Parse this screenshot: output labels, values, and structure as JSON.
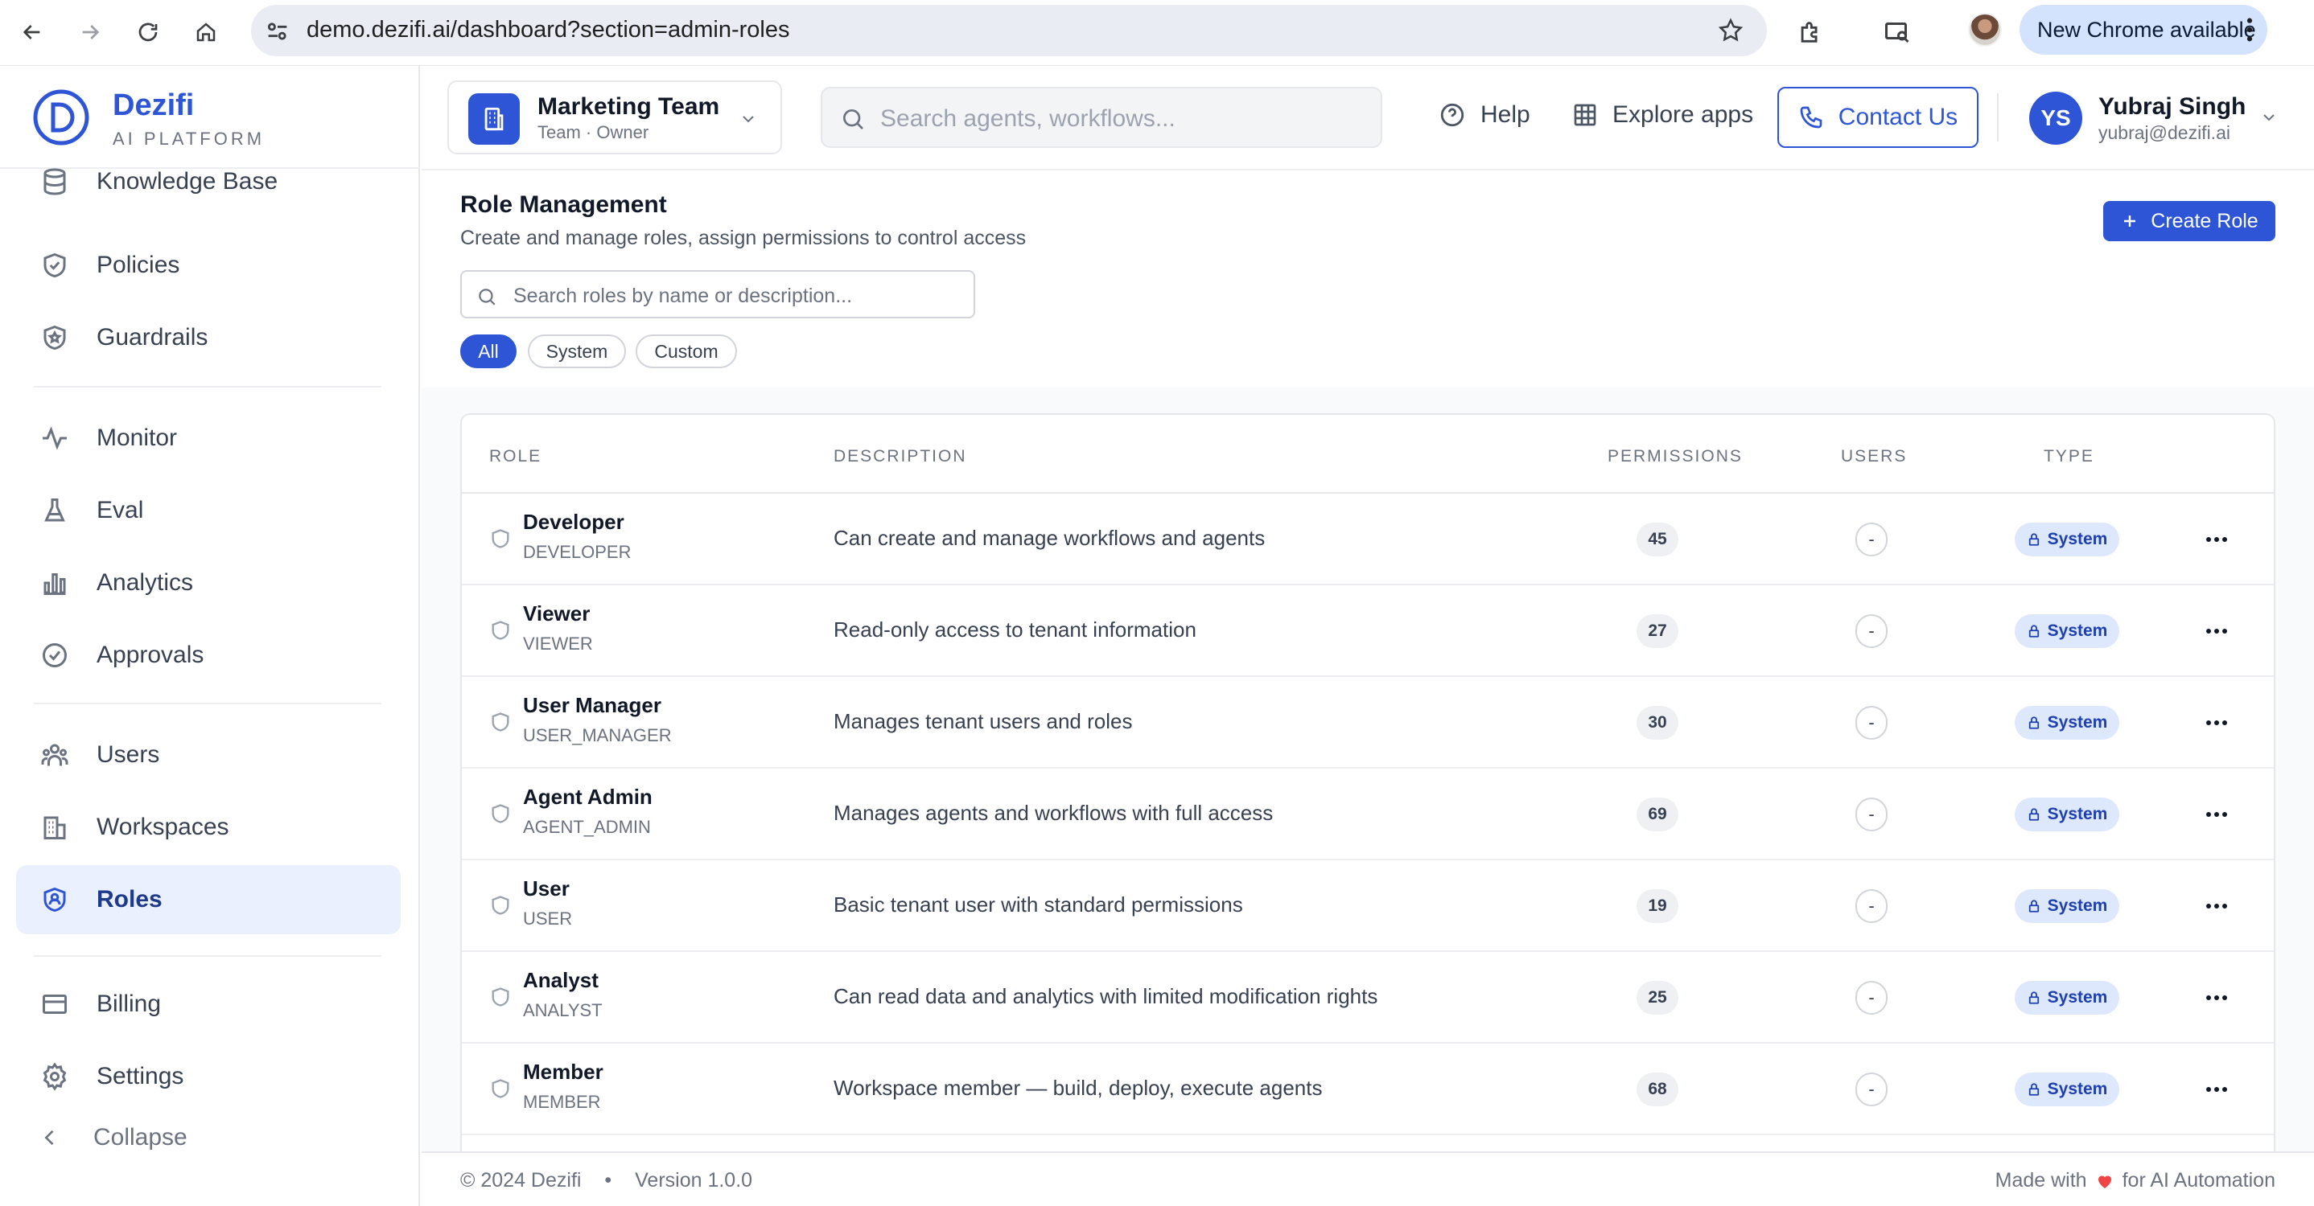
{
  "browser": {
    "url": "demo.dezifi.ai/dashboard?section=admin-roles",
    "update_label": "New Chrome available"
  },
  "brand": {
    "name": "Dezifi",
    "subtitle": "AI PLATFORM",
    "color": "#2d55d6"
  },
  "sidebar": {
    "items": [
      {
        "label": "Knowledge Base",
        "icon": "database-icon"
      },
      {
        "label": "Policies",
        "icon": "shield-check-icon"
      },
      {
        "label": "Guardrails",
        "icon": "shield-star-icon"
      },
      {
        "label": "Monitor",
        "icon": "activity-icon"
      },
      {
        "label": "Eval",
        "icon": "flask-icon"
      },
      {
        "label": "Analytics",
        "icon": "bar-chart-icon"
      },
      {
        "label": "Approvals",
        "icon": "check-circle-icon"
      },
      {
        "label": "Users",
        "icon": "users-icon"
      },
      {
        "label": "Workspaces",
        "icon": "building-icon"
      },
      {
        "label": "Roles",
        "icon": "shield-user-icon",
        "active": true
      },
      {
        "label": "Billing",
        "icon": "card-icon"
      },
      {
        "label": "Settings",
        "icon": "gear-icon"
      }
    ],
    "collapse_label": "Collapse"
  },
  "topbar": {
    "team_name": "Marketing Team",
    "team_sub": "Team · Owner",
    "search_placeholder": "Search agents, workflows...",
    "help_label": "Help",
    "explore_label": "Explore apps",
    "contact_label": "Contact Us",
    "user_initials": "YS",
    "user_name": "Yubraj Singh",
    "user_email": "yubraj@dezifi.ai"
  },
  "page": {
    "title": "Role Management",
    "subtitle": "Create and manage roles, assign permissions to control access",
    "create_label": "Create Role",
    "search_placeholder": "Search roles by name or description...",
    "filters": [
      "All",
      "System",
      "Custom"
    ],
    "active_filter": "All"
  },
  "table": {
    "columns": [
      "ROLE",
      "DESCRIPTION",
      "PERMISSIONS",
      "USERS",
      "TYPE"
    ],
    "rows": [
      {
        "name": "Developer",
        "code": "DEVELOPER",
        "description": "Can create and manage workflows and agents",
        "permissions": "45",
        "users": "-",
        "type": "System"
      },
      {
        "name": "Viewer",
        "code": "VIEWER",
        "description": "Read-only access to tenant information",
        "permissions": "27",
        "users": "-",
        "type": "System"
      },
      {
        "name": "User Manager",
        "code": "USER_MANAGER",
        "description": "Manages tenant users and roles",
        "permissions": "30",
        "users": "-",
        "type": "System"
      },
      {
        "name": "Agent Admin",
        "code": "AGENT_ADMIN",
        "description": "Manages agents and workflows with full access",
        "permissions": "69",
        "users": "-",
        "type": "System"
      },
      {
        "name": "User",
        "code": "USER",
        "description": "Basic tenant user with standard permissions",
        "permissions": "19",
        "users": "-",
        "type": "System"
      },
      {
        "name": "Analyst",
        "code": "ANALYST",
        "description": "Can read data and analytics with limited modification rights",
        "permissions": "25",
        "users": "-",
        "type": "System"
      },
      {
        "name": "Member",
        "code": "MEMBER",
        "description": "Workspace member — build, deploy, execute agents",
        "permissions": "68",
        "users": "-",
        "type": "System"
      }
    ]
  },
  "footer": {
    "copyright": "© 2024 Dezifi",
    "separator": "•",
    "version": "Version 1.0.0",
    "made_with": "Made with",
    "made_for": "for AI Automation"
  }
}
